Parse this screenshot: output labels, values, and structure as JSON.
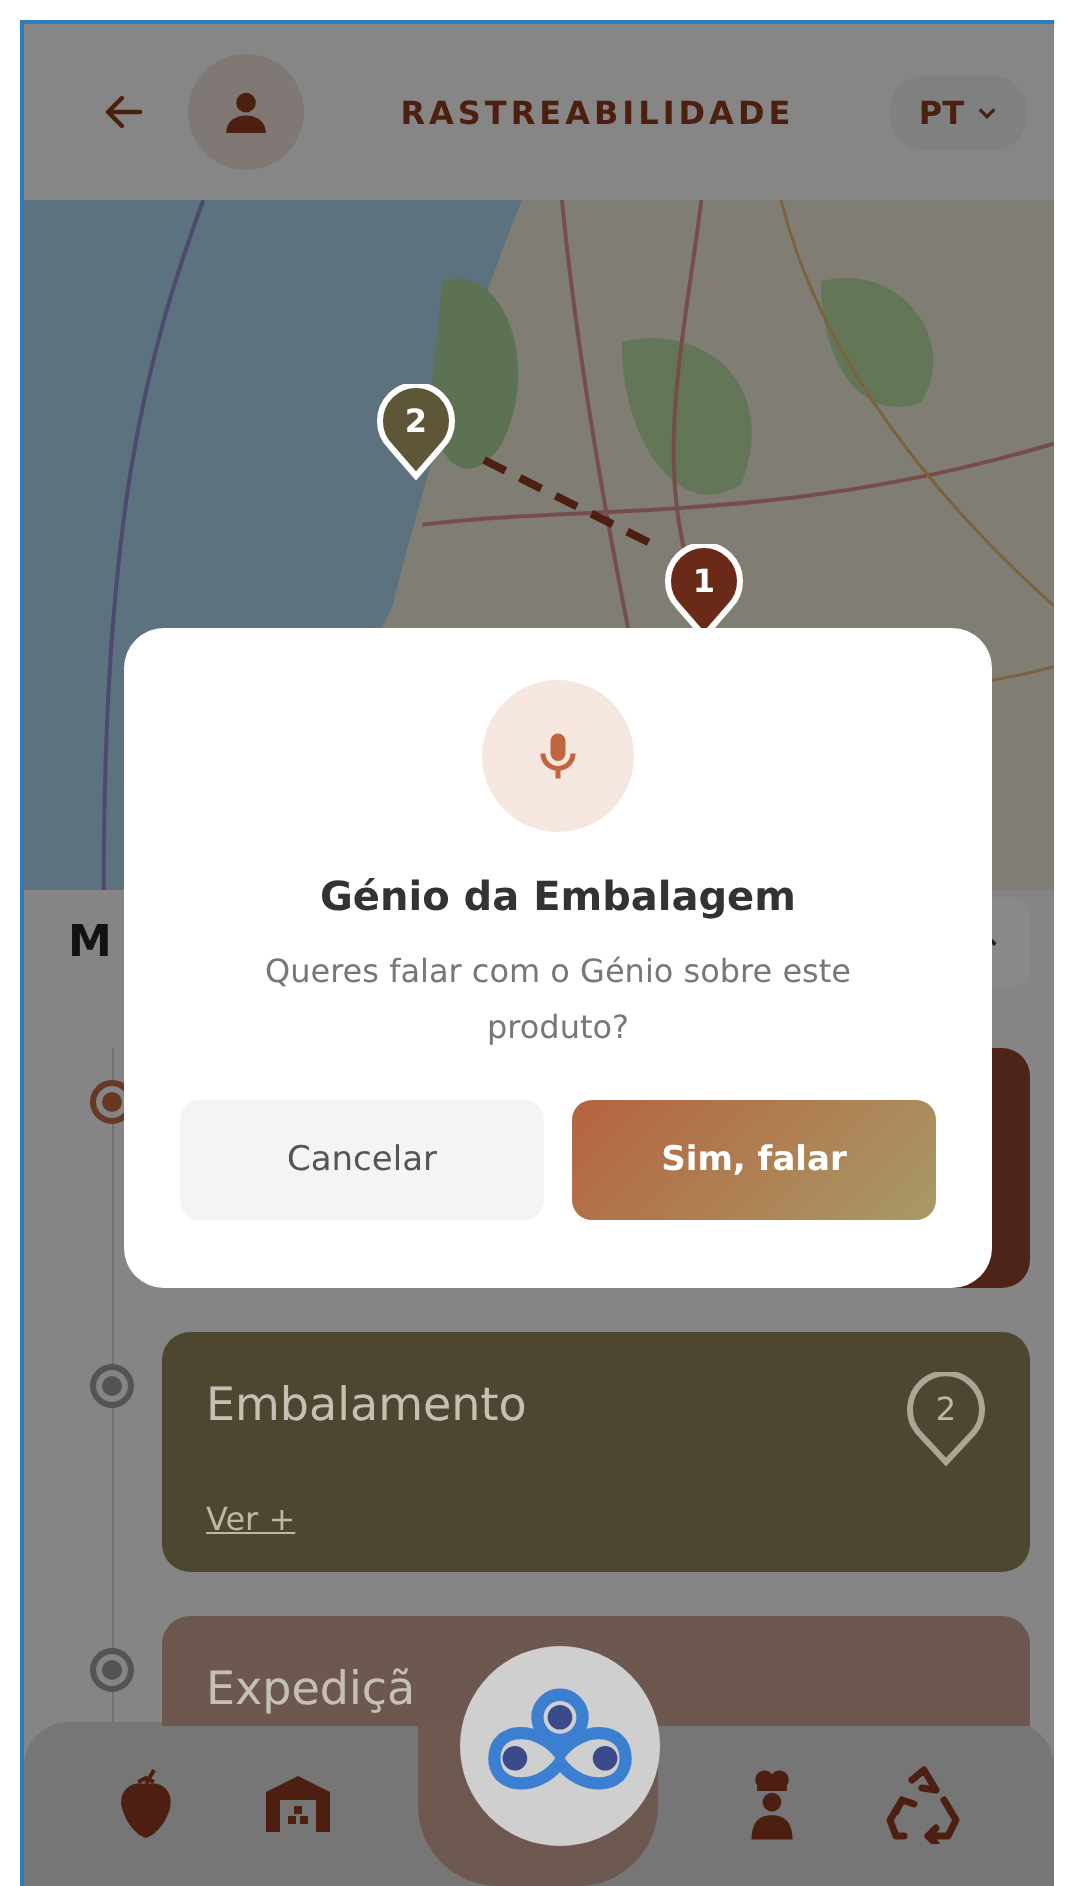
{
  "header": {
    "title": "RASTREABILIDADE",
    "language": "PT"
  },
  "map": {
    "kind": "picture",
    "markers": [
      {
        "label": "2",
        "color": "#5d5637"
      },
      {
        "label": "1",
        "color": "#6a2a17"
      }
    ]
  },
  "panel": {
    "heading": "M",
    "expanded": true
  },
  "stages": [
    {
      "color": "#4f2418",
      "active": true
    },
    {
      "title": "Embalamento",
      "color": "#4d4631",
      "active": false,
      "pin": "2",
      "link": "Ver +"
    },
    {
      "title": "Expediçã",
      "color": "#6d584f",
      "active": false
    }
  ],
  "nav": [
    {
      "kind": "strawberry"
    },
    {
      "kind": "warehouse"
    },
    {
      "kind": "logo"
    },
    {
      "kind": "chef"
    },
    {
      "kind": "recycle"
    }
  ],
  "dialog": {
    "title": "Génio da Embalagem",
    "message": "Queres falar com o Génio sobre este produto?",
    "buttons": [
      {
        "label": "Cancelar",
        "kind": "secondary"
      },
      {
        "label": "Sim, falar",
        "kind": "primary"
      }
    ]
  }
}
